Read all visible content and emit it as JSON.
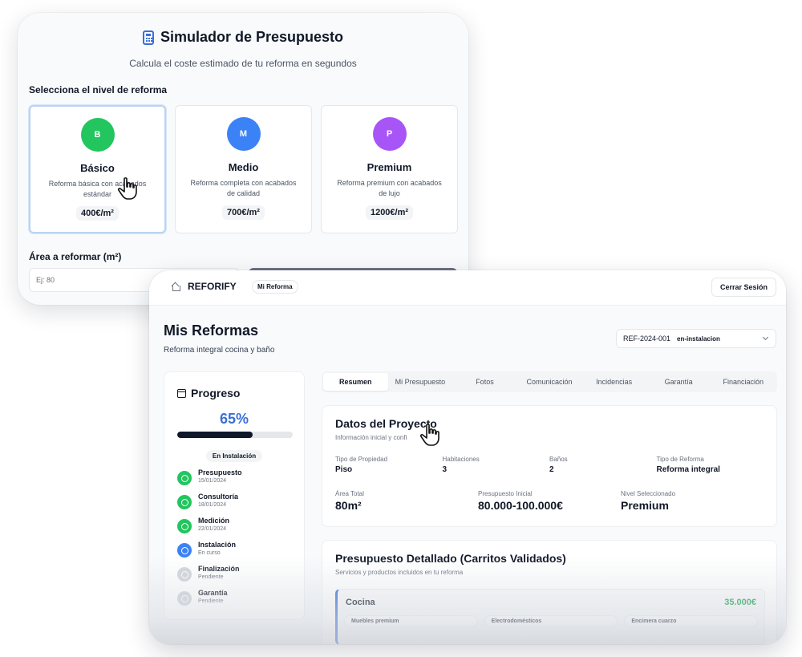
{
  "simulator": {
    "title": "Simulador de Presupuesto",
    "subtitle": "Calcula el coste estimado de tu reforma en segundos",
    "level_label": "Selecciona el nivel de reforma",
    "tiers": [
      {
        "letter": "B",
        "name": "Básico",
        "description": "Reforma básica con acabados estándar",
        "price": "400€/m²",
        "color": "#22c55e",
        "selected": true
      },
      {
        "letter": "M",
        "name": "Medio",
        "description": "Reforma completa con acabados de calidad",
        "price": "700€/m²",
        "color": "#3b82f6",
        "selected": false
      },
      {
        "letter": "P",
        "name": "Premium",
        "description": "Reforma premium con acabados de lujo",
        "price": "1200€/m²",
        "color": "#a855f7",
        "selected": false
      }
    ],
    "area_label": "Área a reformar (m²)",
    "area_placeholder": "Ej: 80"
  },
  "dashboard": {
    "brand": "REFORIFY",
    "nav_tab": "Mi Reforma",
    "logout": "Cerrar Sesión",
    "title": "Mis Reformas",
    "subtitle": "Reforma integral cocina y baño",
    "ref_select": {
      "code": "REF-2024-001",
      "status": "en-instalacion"
    },
    "progress": {
      "title": "Progreso",
      "percent_label": "65%",
      "percent": 65,
      "stage": "En Instalación",
      "steps": [
        {
          "name": "Presupuesto",
          "detail": "15/01/2024",
          "state": "done"
        },
        {
          "name": "Consultoría",
          "detail": "18/01/2024",
          "state": "done"
        },
        {
          "name": "Medición",
          "detail": "22/01/2024",
          "state": "done"
        },
        {
          "name": "Instalación",
          "detail": "En curso",
          "state": "current"
        },
        {
          "name": "Finalización",
          "detail": "Pendiente",
          "state": "pending"
        },
        {
          "name": "Garantía",
          "detail": "Pendiente",
          "state": "pending"
        }
      ]
    },
    "tabs": [
      "Resumen",
      "Mi Presupuesto",
      "Fotos",
      "Comunicación",
      "Incidencias",
      "Garantía",
      "Financiación"
    ],
    "active_tab": "Resumen",
    "project": {
      "title": "Datos del Proyecto",
      "subtitle": "Información inicial y confi",
      "property_type_label": "Tipo de Propiedad",
      "property_type": "Piso",
      "rooms_label": "Habitaciones",
      "rooms": "3",
      "bathrooms_label": "Baños",
      "bathrooms": "2",
      "reform_type_label": "Tipo de Reforma",
      "reform_type": "Reforma integral",
      "total_area_label": "Área Total",
      "total_area": "80m²",
      "initial_budget_label": "Presupuesto Inicial",
      "initial_budget": "80.000-100.000€",
      "level_label": "Nivel Seleccionado",
      "level": "Premium"
    },
    "budget": {
      "title": "Presupuesto Detallado (Carritos Validados)",
      "subtitle": "Servicios y productos incluidos en tu reforma",
      "room": "Cocina",
      "room_total": "35.000€",
      "items": [
        "Muebles premium",
        "Electrodomésticos",
        "Encimera cuarzo"
      ]
    }
  }
}
